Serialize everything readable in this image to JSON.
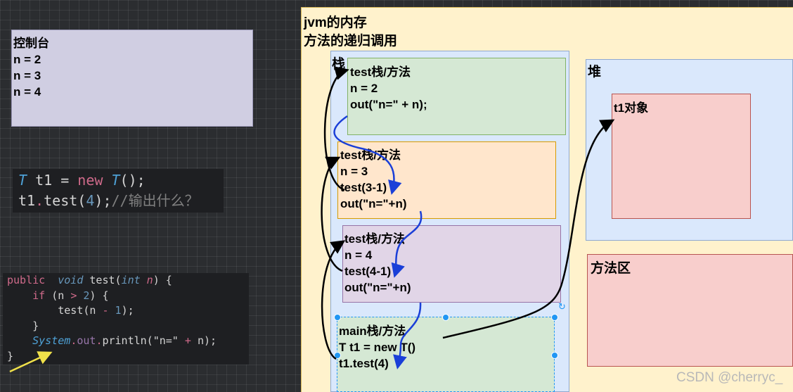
{
  "console": {
    "title": "控制台",
    "lines": [
      "n = 2",
      "n = 3",
      "n = 4"
    ]
  },
  "snippet1": {
    "type": "T",
    "var": " t1 ",
    "op": "=",
    "new_kw": " new ",
    "type2": "T",
    "call": "();",
    "line2_obj": "t1",
    "line2_dot": ".",
    "line2_method": "test(",
    "line2_arg": "4",
    "line2_end": ");",
    "line2_comment": "//输出什么？"
  },
  "snippet2": {
    "l1_public": "public",
    "l1_void": "void",
    "l1_name": " test(",
    "l1_int": "int",
    "l1_n": " n",
    "l1_end": ") {",
    "l2_if": "if",
    "l2_rest": " (n ",
    "l2_gt": ">",
    "l2_sp": " ",
    "l2_two": "2",
    "l2_end": ") {",
    "l3": "test(n ",
    "l3_minus": "-",
    "l3_sp": " ",
    "l3_one": "1",
    "l3_end": ");",
    "l4": "}",
    "l5_system": "System",
    "l5_dot1": ".",
    "l5_out": "out",
    "l5_dot2": ".",
    "l5_println": "println(",
    "l5_str": "\"n=\"",
    "l5_plus": " + ",
    "l5_end": "n);",
    "l6": "}"
  },
  "memory": {
    "title1": "jvm的内存",
    "title2": "方法的递归调用"
  },
  "stack": {
    "label": "栈"
  },
  "frames": [
    {
      "lines": [
        "test栈/方法",
        "n = 2",
        "out(\"n=\" + n);"
      ]
    },
    {
      "lines": [
        "test栈/方法",
        "n = 3",
        "test(3-1)",
        "out(\"n=\"+n)"
      ]
    },
    {
      "lines": [
        "test栈/方法",
        "n = 4",
        "test(4-1)",
        "out(\"n=\"+n)"
      ]
    },
    {
      "lines": [
        "main栈/方法",
        "T t1 = new T()",
        "t1.test(4)"
      ]
    }
  ],
  "heap": {
    "label": "堆",
    "object": "t1对象"
  },
  "method_area": {
    "label": "方法区"
  },
  "watermark": "CSDN @cherryc_",
  "colors": {
    "panel_bg": "#fff2cc",
    "stack_bg": "#dae8fc",
    "green": "#d5e8d4",
    "orange": "#ffe6cc",
    "purple": "#e1d5e7",
    "red": "#f8cecc",
    "console_bg": "#d0cee2"
  }
}
